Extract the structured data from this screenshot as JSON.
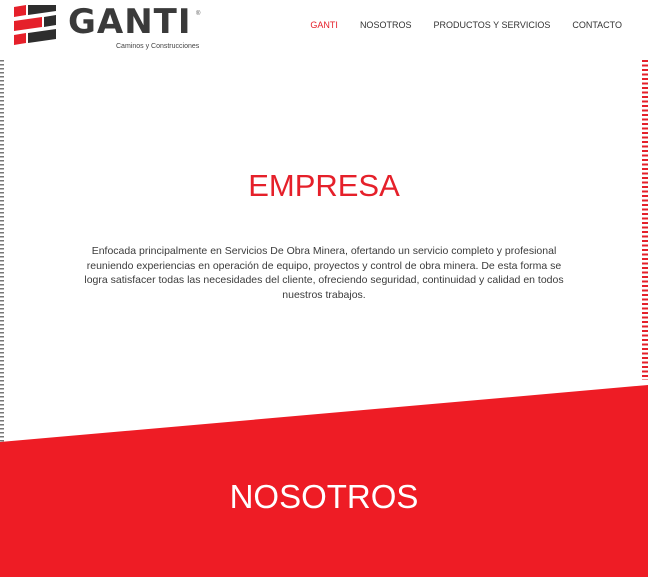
{
  "brand": {
    "name": "GANTI",
    "registered": "®",
    "tagline": "Caminos y Construcciones",
    "colors": {
      "red": "#e5202a",
      "dark": "#3a3a3a"
    }
  },
  "nav": {
    "items": [
      {
        "label": "GANTI",
        "active": true
      },
      {
        "label": "NOSOTROS",
        "active": false
      },
      {
        "label": "PRODUCTOS Y SERVICIOS",
        "active": false
      },
      {
        "label": "CONTACTO",
        "active": false
      }
    ]
  },
  "empresa": {
    "title": "EMPRESA",
    "body": "Enfocada principalmente en Servicios De Obra Minera, ofertando un servicio completo y profesional reuniendo experiencias en operación de equipo, proyectos y control de obra minera. De esta forma se logra satisfacer todas las necesidades del cliente, ofreciendo seguridad, continuidad y calidad en todos nuestros trabajos."
  },
  "nosotros": {
    "title": "NOSOTROS"
  }
}
